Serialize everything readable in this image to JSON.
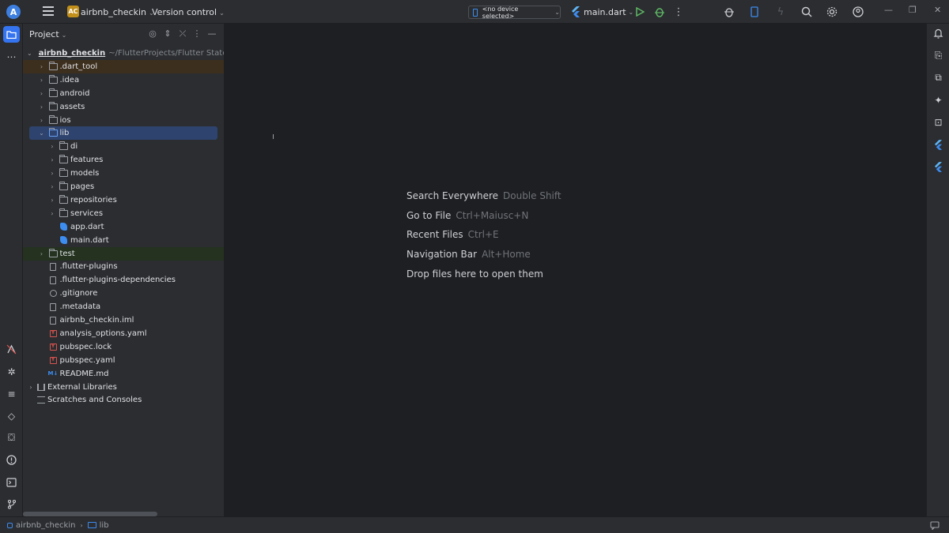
{
  "titlebar": {
    "project_badge": "AC",
    "project_name": "airbnb_checkin",
    "version_control": "Version control",
    "device_selector": "<no device selected>",
    "run_config": "main.dart"
  },
  "project_panel": {
    "title": "Project",
    "root": {
      "name": "airbnb_checkin",
      "path": "~/FlutterProjects/Flutter State M..."
    },
    "tree": [
      {
        "label": ".dart_tool",
        "kind": "folder",
        "depth": 1,
        "expandable": true,
        "state": "excluded"
      },
      {
        "label": ".idea",
        "kind": "folder",
        "depth": 1,
        "expandable": true
      },
      {
        "label": "android",
        "kind": "folder",
        "depth": 1,
        "expandable": true
      },
      {
        "label": "assets",
        "kind": "folder",
        "depth": 1,
        "expandable": true
      },
      {
        "label": "ios",
        "kind": "folder",
        "depth": 1,
        "expandable": true
      },
      {
        "label": "lib",
        "kind": "folder",
        "depth": 1,
        "expandable": true,
        "expanded": true,
        "state": "selected"
      },
      {
        "label": "di",
        "kind": "folder",
        "depth": 2,
        "expandable": true
      },
      {
        "label": "features",
        "kind": "folder",
        "depth": 2,
        "expandable": true
      },
      {
        "label": "models",
        "kind": "folder",
        "depth": 2,
        "expandable": true
      },
      {
        "label": "pages",
        "kind": "folder",
        "depth": 2,
        "expandable": true
      },
      {
        "label": "repositories",
        "kind": "folder",
        "depth": 2,
        "expandable": true
      },
      {
        "label": "services",
        "kind": "folder",
        "depth": 2,
        "expandable": true
      },
      {
        "label": "app.dart",
        "kind": "dart",
        "depth": 2
      },
      {
        "label": "main.dart",
        "kind": "dart",
        "depth": 2
      },
      {
        "label": "test",
        "kind": "folder",
        "depth": 1,
        "expandable": true,
        "state": "test"
      },
      {
        "label": ".flutter-plugins",
        "kind": "file",
        "depth": 1
      },
      {
        "label": ".flutter-plugins-dependencies",
        "kind": "file",
        "depth": 1
      },
      {
        "label": ".gitignore",
        "kind": "ignore",
        "depth": 1
      },
      {
        "label": ".metadata",
        "kind": "file",
        "depth": 1
      },
      {
        "label": "airbnb_checkin.iml",
        "kind": "file",
        "depth": 1
      },
      {
        "label": "analysis_options.yaml",
        "kind": "yaml",
        "depth": 1
      },
      {
        "label": "pubspec.lock",
        "kind": "yaml",
        "depth": 1
      },
      {
        "label": "pubspec.yaml",
        "kind": "yaml",
        "depth": 1
      },
      {
        "label": "README.md",
        "kind": "md",
        "depth": 1
      },
      {
        "label": "External Libraries",
        "kind": "library",
        "depth": 0,
        "expandable": true
      },
      {
        "label": "Scratches and Consoles",
        "kind": "scratch",
        "depth": 0
      }
    ]
  },
  "editor_hints": [
    {
      "label": "Search Everywhere",
      "shortcut": "Double Shift"
    },
    {
      "label": "Go to File",
      "shortcut": "Ctrl+Maiusc+N"
    },
    {
      "label": "Recent Files",
      "shortcut": "Ctrl+E"
    },
    {
      "label": "Navigation Bar",
      "shortcut": "Alt+Home"
    },
    {
      "label": "Drop files here to open them",
      "shortcut": ""
    }
  ],
  "statusbar": {
    "crumbs": [
      "airbnb_checkin",
      "lib"
    ]
  },
  "colors": {
    "accent": "#3574f0",
    "selection": "#2e436e",
    "excluded_bg": "#3d2f1e",
    "test_bg": "#24321f"
  }
}
